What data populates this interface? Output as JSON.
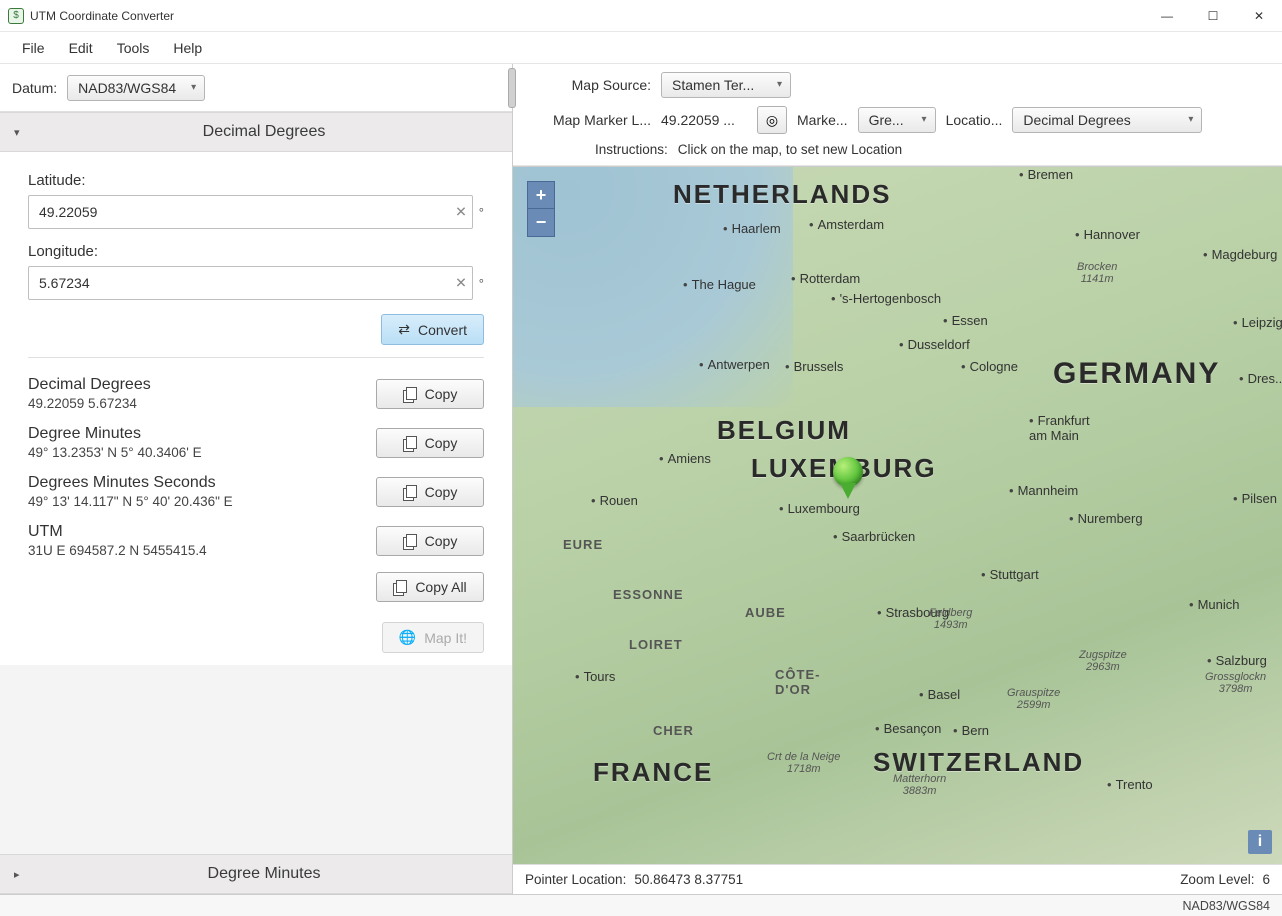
{
  "window": {
    "title": "UTM Coordinate Converter"
  },
  "menu": {
    "file": "File",
    "edit": "Edit",
    "tools": "Tools",
    "help": "Help"
  },
  "datum": {
    "label": "Datum:",
    "value": "NAD83/WGS84"
  },
  "panels": {
    "decimal_degrees": "Decimal Degrees",
    "degree_minutes": "Degree Minutes",
    "dms": "Degrees Minutes Seconds"
  },
  "inputs": {
    "lat_label": "Latitude:",
    "lat_value": "49.22059",
    "lon_label": "Longitude:",
    "lon_value": "5.67234",
    "degree_symbol": "°"
  },
  "buttons": {
    "convert": "Convert",
    "copy": "Copy",
    "copy_all": "Copy All",
    "map_it": "Map It!"
  },
  "results": {
    "dd": {
      "title": "Decimal Degrees",
      "value": "49.22059 5.67234"
    },
    "dm": {
      "title": "Degree Minutes",
      "value": "49° 13.2353' N 5° 40.3406' E"
    },
    "dms": {
      "title": "Degrees Minutes Seconds",
      "value": "49° 13' 14.117\" N 5° 40' 20.436\" E"
    },
    "utm": {
      "title": "UTM",
      "value": "31U E 694587.2 N 5455415.4"
    }
  },
  "map_toolbar": {
    "source_label": "Map Source:",
    "source_value": "Stamen Ter...",
    "marker_loc_label": "Map Marker L...",
    "marker_loc_value": "49.22059 ...",
    "marker_color_label": "Marke...",
    "marker_color_value": "Gre...",
    "loc_format_label": "Locatio...",
    "loc_format_value": "Decimal Degrees",
    "instructions_label": "Instructions:",
    "instructions_text": "Click on the map, to set new Location"
  },
  "map": {
    "countries": {
      "netherlands": "NETHERLANDS",
      "belgium": "BELGIUM",
      "luxemburg": "LUXEMBURG",
      "germany": "GERMANY",
      "france": "FRANCE",
      "switzerland": "SWITZERLAND"
    },
    "regions": {
      "eure": "EURE",
      "essonne": "ESSONNE",
      "loiret": "LOIRET",
      "cher": "CHER",
      "aube": "AUBE",
      "cotedor": "CÔTE-\nD'OR"
    },
    "cities": {
      "bremen": "Bremen",
      "haarlem": "Haarlem",
      "amsterdam": "Amsterdam",
      "hannover": "Hannover",
      "magdeburg": "Magdeburg",
      "the_hague": "The Hague",
      "rotterdam": "Rotterdam",
      "shertogenbosch": "'s-Hertogenbosch",
      "essen": "Essen",
      "leipzig": "Leipzig",
      "dusseldorf": "Dusseldorf",
      "antwerpen": "Antwerpen",
      "brussels": "Brussels",
      "cologne": "Cologne",
      "dresden": "Dres...",
      "frankfurt": "Frankfurt\nam Main",
      "amiens": "Amiens",
      "mannheim": "Mannheim",
      "pilsen": "Pilsen",
      "rouen": "Rouen",
      "luxembourg": "Luxembourg",
      "nuremberg": "Nuremberg",
      "saarbrucken": "Saarbrücken",
      "stuttgart": "Stuttgart",
      "munich": "Munich",
      "strasbourg": "Strasbourg",
      "tours": "Tours",
      "basel": "Basel",
      "salzburg": "Salzburg",
      "besancon": "Besançon",
      "bern": "Bern",
      "trento": "Trento"
    },
    "mountains": {
      "brocken": "Brocken\n1141m",
      "feldberg": "Feldberg\n1493m",
      "zugspitze": "Zugspitze\n2963m",
      "grauspitze": "Grauspitze\n2599m",
      "grossglockner": "Grossglockn\n3798m",
      "crt": "Crt de la Neige\n1718m",
      "matterhorn": "Matterhorn\n3883m"
    }
  },
  "map_status": {
    "pointer_label": "Pointer Location:",
    "pointer_value": "50.86473 8.37751",
    "zoom_label": "Zoom Level:",
    "zoom_value": "6"
  },
  "statusbar": {
    "datum": "NAD83/WGS84"
  }
}
